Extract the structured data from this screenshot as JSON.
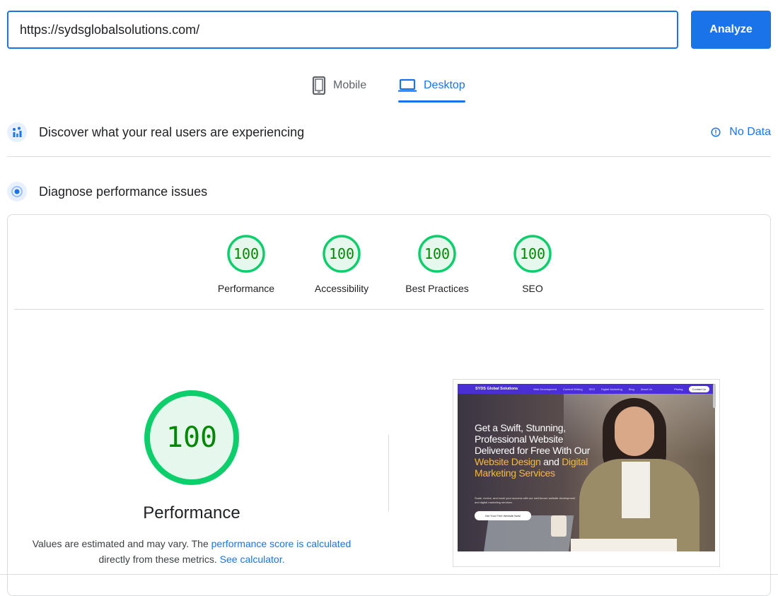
{
  "search": {
    "url_value": "https://sydsglobalsolutions.com/",
    "analyze_label": "Analyze"
  },
  "tabs": [
    {
      "label": "Mobile",
      "icon": "phone-icon",
      "selected": false
    },
    {
      "label": "Desktop",
      "icon": "laptop-icon",
      "selected": true
    }
  ],
  "field_data": {
    "title": "Discover what your real users are experiencing",
    "status": "No Data"
  },
  "diagnose": {
    "title": "Diagnose performance issues"
  },
  "scores": [
    {
      "label": "Performance",
      "value": "100"
    },
    {
      "label": "Accessibility",
      "value": "100"
    },
    {
      "label": "Best Practices",
      "value": "100"
    },
    {
      "label": "SEO",
      "value": "100"
    }
  ],
  "performance": {
    "score": "100",
    "title": "Performance",
    "note_prefix": "Values are estimated and may vary. The ",
    "note_link": "performance score is calculated",
    "note_middle": " directly from these metrics. ",
    "calc_link": "See calculator."
  },
  "screenshot": {
    "brand": "SYDS Global Solutions",
    "nav_links": [
      "Web Development",
      "Content Writing",
      "SEO",
      "Digital Marketing",
      "Blog",
      "About Us"
    ],
    "pricing": "Pricing",
    "contact": "Contact Us",
    "headline_1": "Get a Swift, Stunning, Professional Website Delivered for Free With Our ",
    "headline_hl1": "Website Design",
    "headline_2": " and ",
    "headline_hl2": "Digital Marketing Services",
    "subtext": "Scale, evolve, and excel your success with our well-known website development and digital marketing services.",
    "cta": "Get Your Free Website Now!"
  },
  "colors": {
    "accent": "#1a73e8",
    "pass": "#0cce6b",
    "pass_fill": "#e6f8ed",
    "pass_text": "#008800"
  }
}
